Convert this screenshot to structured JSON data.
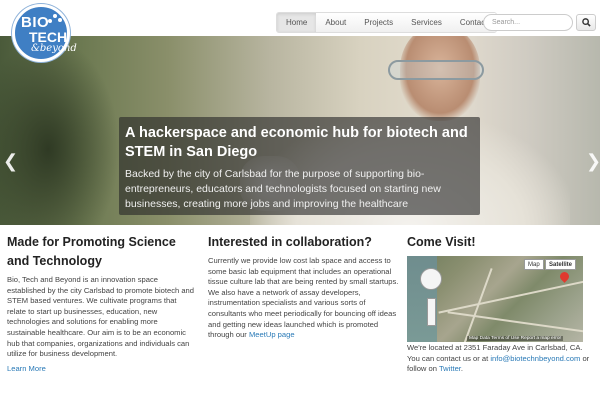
{
  "logo": {
    "line1": "BIO",
    "line2": "TECH",
    "line3": "&beyond"
  },
  "nav": {
    "items": [
      "Home",
      "About",
      "Projects",
      "Services",
      "Contact"
    ],
    "active": "Home"
  },
  "search": {
    "placeholder": "Search..."
  },
  "hero": {
    "title": "A hackerspace and economic hub for biotech and STEM in San Diego",
    "text": "Backed by the city of Carlsbad for the purpose of supporting bio-entrepreneurs, educators and technologists focused on starting new businesses, creating more jobs and improving the healthcare"
  },
  "col1": {
    "heading": "Made for Promoting Science and Technology",
    "body": "Bio, Tech and Beyond is an innovation space established by the city Carlsbad to promote biotech and STEM based ventures. We cultivate programs that relate to start up businesses, education, new technologies and solutions for enabling more sustainable healthcare. Our aim is to be an economic hub that companies, organizations and individuals can utilize for business development.",
    "link": "Learn More"
  },
  "col2": {
    "heading": "Interested in collaboration?",
    "body": "Currently we provide low cost lab space and access to some basic lab equipment that includes an operational tissue culture lab that are being rented by small startups. We also have a network of assay developers, instrumentation specialists and various sorts of consultants who meet periodically for bouncing off ideas and getting new ideas launched which is promoted through our ",
    "link": "MeetUp page"
  },
  "col3": {
    "heading": "Come Visit!",
    "map": {
      "btn_map": "Map",
      "btn_satellite": "Satellite",
      "footer": "Map Data  Terms of Use  Report a map error"
    },
    "text1": "We're located at 2351 Faraday Ave in Carlsbad, CA. You can contact us or at ",
    "email": "info@biotechnbeyond.com",
    "text2": " or follow on ",
    "twitter": "Twitter",
    "text3": "."
  },
  "colors": {
    "link": "#2a7ab7",
    "logo": "#3f7fc4",
    "caption_bg": "rgba(40,40,40,0.62)"
  }
}
